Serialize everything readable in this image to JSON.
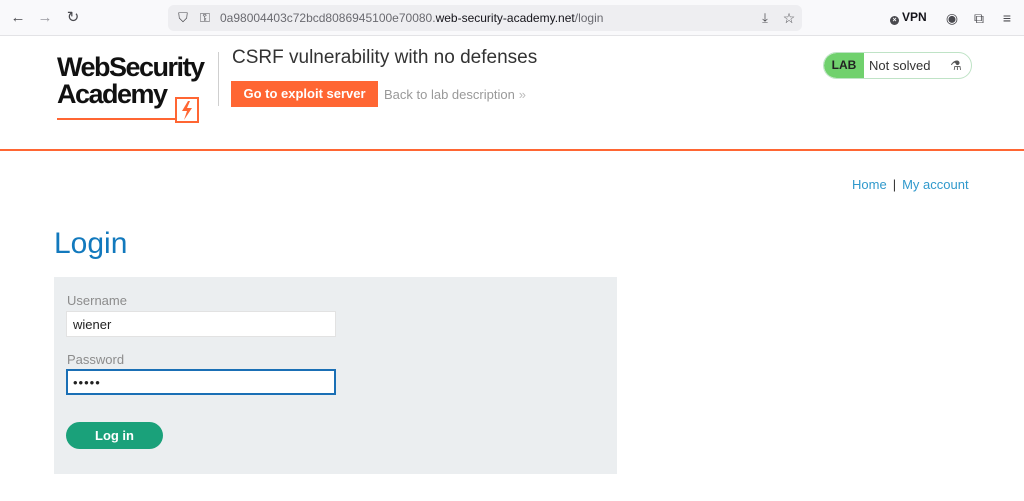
{
  "browser": {
    "url_prefix": "0a98004403c72bcd8086945100e70080.",
    "url_domain": "web-security-academy.net",
    "url_path": "/login",
    "vpn_label": "VPN",
    "icons": {
      "back": "←",
      "forward": "→",
      "reload": "↻",
      "shield": "⛉",
      "key": "⚿",
      "download": "⤓",
      "star": "☆",
      "vpn_dot": "×",
      "account": "◉",
      "extensions": "⧉",
      "menu": "≡"
    }
  },
  "header": {
    "logo_line1": "WebSecurity",
    "logo_line2": "Academy",
    "lab_title": "CSRF vulnerability with no defenses",
    "exploit_button": "Go to exploit server",
    "back_link": "Back to lab description",
    "back_chevron": "»",
    "lab_badge": "LAB",
    "lab_state": "Not solved",
    "flask_icon": "⚗"
  },
  "nav": {
    "home": "Home",
    "separator": "|",
    "my_account": "My account"
  },
  "login": {
    "title": "Login",
    "username_label": "Username",
    "username_value": "wiener",
    "password_label": "Password",
    "password_value": "peter",
    "submit_label": "Log in"
  },
  "colors": {
    "accent_orange": "#ff6633",
    "link_blue": "#3099cc",
    "title_blue": "#1279bd",
    "button_green": "#1aa17a",
    "lab_badge_green": "#70d16d"
  }
}
